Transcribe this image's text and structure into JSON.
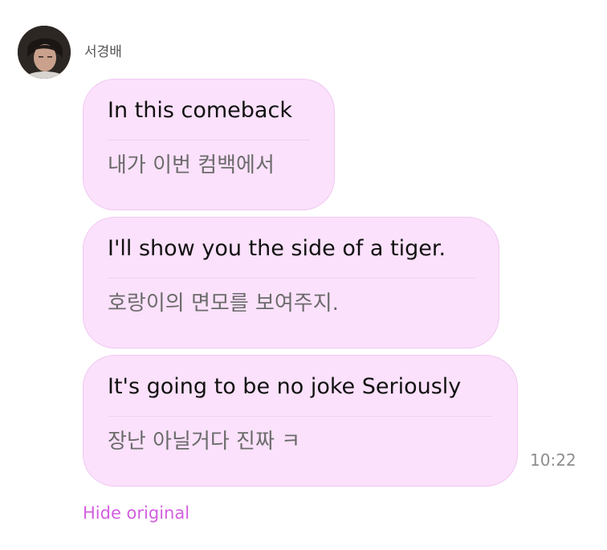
{
  "sender": {
    "name": "서경배"
  },
  "messages": [
    {
      "original": "In this comeback",
      "translation": "내가 이번 컴백에서"
    },
    {
      "original": "I'll show you the side of a tiger.",
      "translation": "호랑이의 면모를 보여주지."
    },
    {
      "original": "It's going to be no joke Seriously",
      "translation": "장난 아닐거다 진짜 ㅋ"
    }
  ],
  "timestamp": "10:22",
  "hide_original_label": "Hide original",
  "colors": {
    "bubble_bg": "#fbe1fb",
    "bubble_border": "#f0c8f2",
    "link_accent": "#d35ee0",
    "translation_text": "#6b6b6b",
    "timestamp_text": "#8e8e8e"
  }
}
